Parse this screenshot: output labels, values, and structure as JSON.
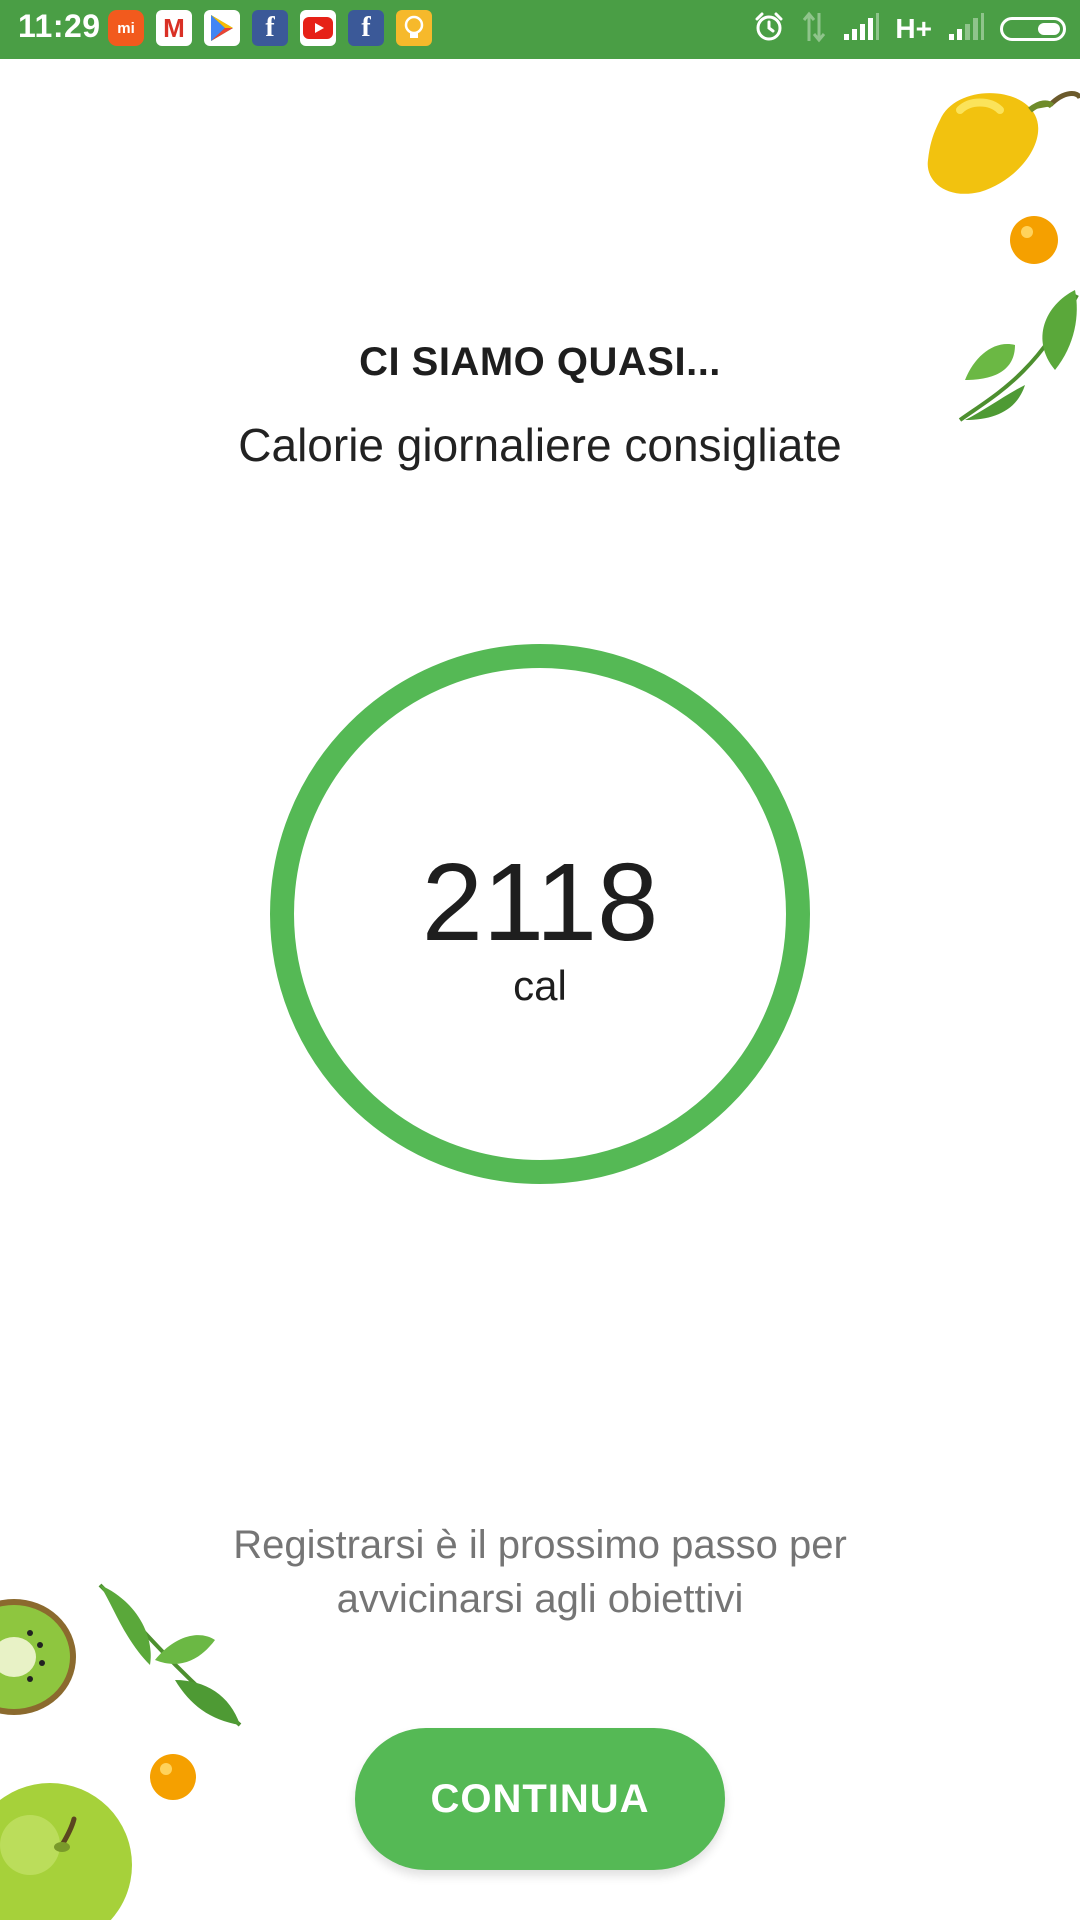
{
  "status_bar": {
    "time": "11:29",
    "network_type": "H+",
    "color": "#4a9e45",
    "notification_icons": [
      "mi-icon",
      "gmail-icon",
      "play-store-icon",
      "facebook-icon",
      "youtube-icon",
      "facebook-icon",
      "bulb-icon"
    ],
    "system_icons": [
      "alarm-icon",
      "data-arrows-icon",
      "signal-icon",
      "signal-icon",
      "battery-icon"
    ]
  },
  "header": {
    "eyebrow": "CI SIAMO QUASI...",
    "subtitle": "Calorie giornaliere consigliate"
  },
  "calories": {
    "value": "2118",
    "unit": "cal",
    "ring_color": "#55b955"
  },
  "footer": {
    "message": "Registrarsi è il prossimo passo per avvicinarsi agli obiettivi",
    "continue_label": "CONTINUA",
    "button_color": "#55b955"
  },
  "decorations": [
    "yellow-pepper-icon",
    "orange-berry-icon",
    "mint-leaf-icon",
    "kiwi-icon",
    "green-apple-icon"
  ]
}
